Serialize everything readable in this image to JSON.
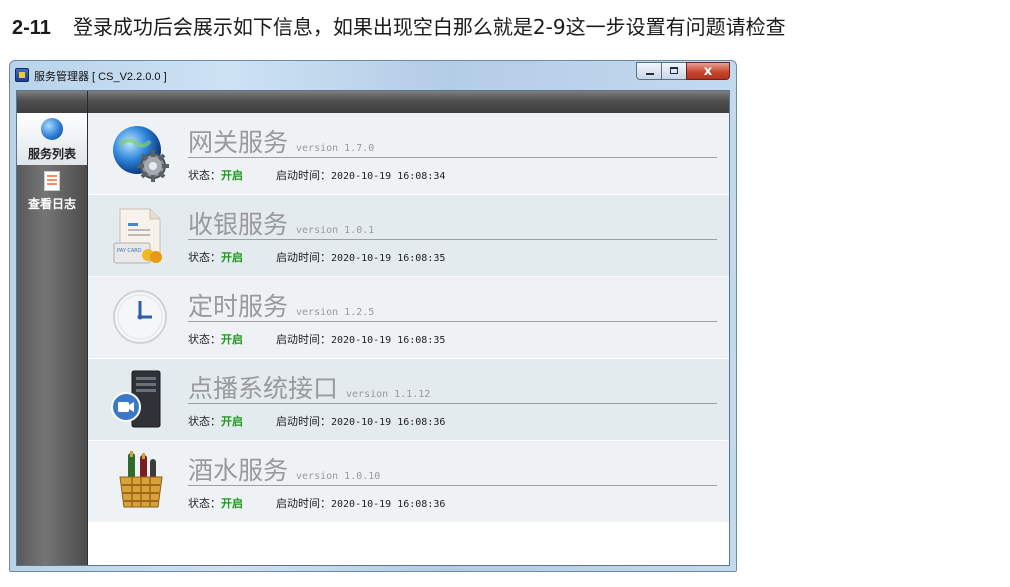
{
  "caption": {
    "number": "2-11",
    "text": "登录成功后会展示如下信息，如果出现空白那么就是2-9这一步设置有问题请检查"
  },
  "window": {
    "title": "服务管理器 [ CS_V2.2.0.0 ]",
    "close_glyph": "x"
  },
  "sidebar": {
    "items": [
      {
        "label": "服务列表",
        "icon": "globe-icon"
      },
      {
        "label": "查看日志",
        "icon": "log-document-icon"
      }
    ]
  },
  "services": [
    {
      "name": "网关服务",
      "version": "version 1.7.0",
      "status_label": "状态：",
      "status": "开启",
      "time_label": "启动时间：",
      "time": "2020-10-19 16:08:34",
      "icon": "gateway-globe-gear-icon"
    },
    {
      "name": "收银服务",
      "version": "version 1.0.1",
      "status_label": "状态：",
      "status": "开启",
      "time_label": "启动时间：",
      "time": "2020-10-19 16:08:35",
      "icon": "cashier-paycard-icon"
    },
    {
      "name": "定时服务",
      "version": "version 1.2.5",
      "status_label": "状态：",
      "status": "开启",
      "time_label": "启动时间：",
      "time": "2020-10-19 16:08:35",
      "icon": "clock-icon"
    },
    {
      "name": "点播系统接口",
      "version": "version 1.1.12",
      "status_label": "状态：",
      "status": "开启",
      "time_label": "启动时间：",
      "time": "2020-10-19 16:08:36",
      "icon": "server-video-icon"
    },
    {
      "name": "酒水服务",
      "version": "version 1.0.10",
      "status_label": "状态：",
      "status": "开启",
      "time_label": "启动时间：",
      "time": "2020-10-19 16:08:36",
      "icon": "wine-basket-icon"
    }
  ],
  "colors": {
    "status_on": "#1e9a1e",
    "service_name": "#9a9a9a"
  }
}
